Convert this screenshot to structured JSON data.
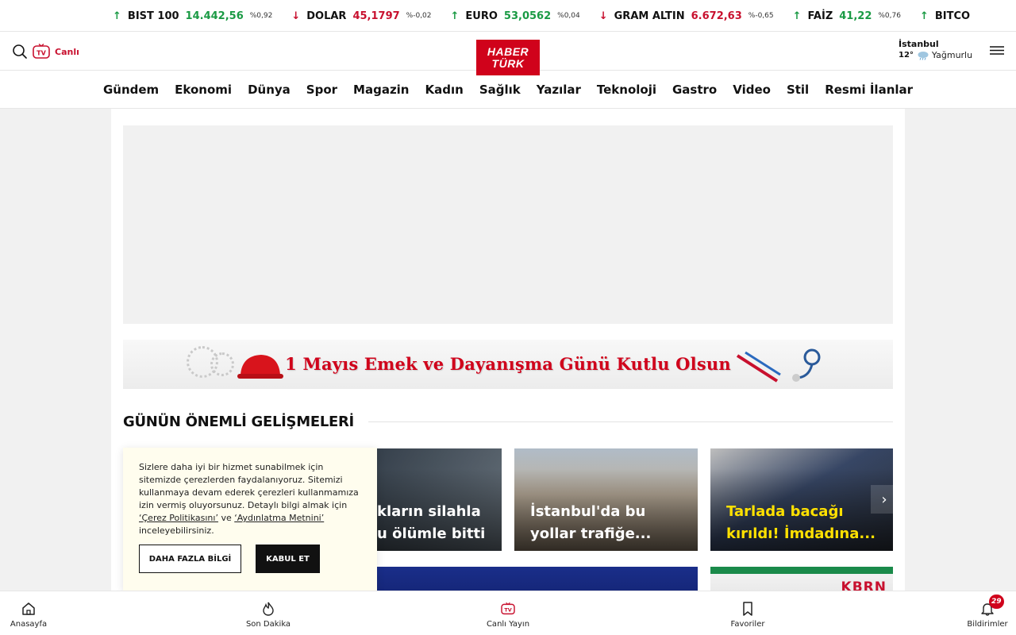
{
  "ticker": [
    {
      "name": "BIST 100",
      "value": "14.442,56",
      "change": "%0,92",
      "dir": "up",
      "arrow": "↑"
    },
    {
      "name": "DOLAR",
      "value": "45,1797",
      "change": "%-0,02",
      "dir": "down",
      "arrow": "↓"
    },
    {
      "name": "EURO",
      "value": "53,0562",
      "change": "%0,04",
      "dir": "up",
      "arrow": "↑"
    },
    {
      "name": "GRAM ALTIN",
      "value": "6.672,63",
      "change": "%-0,65",
      "dir": "down",
      "arrow": "↓"
    },
    {
      "name": "FAİZ",
      "value": "41,22",
      "change": "%0,76",
      "dir": "up",
      "arrow": "↑"
    },
    {
      "name": "BITCO",
      "value": "",
      "change": "",
      "dir": "up",
      "arrow": "↑"
    }
  ],
  "header": {
    "live_label": "Canlı",
    "tv_text": "TV",
    "logo_line1": "HABER",
    "logo_line2": "TÜRK",
    "city": "İstanbul",
    "temperature": "12°",
    "condition": "Yağmurlu"
  },
  "nav": [
    "Gündem",
    "Ekonomi",
    "Dünya",
    "Spor",
    "Magazin",
    "Kadın",
    "Sağlık",
    "Yazılar",
    "Teknoloji",
    "Gastro",
    "Video",
    "Stil",
    "Resmi İlanlar"
  ],
  "banner": {
    "text": "1 Mayıs Emek ve Dayanışma Günü Kutlu Olsun"
  },
  "section": {
    "title": "GÜNÜN ÖNEMLİ GELİŞMELERİ"
  },
  "cards": [
    {
      "title": "kların silahla\nu ölümle bitti"
    },
    {
      "title": "İstanbul'da bu yollar trafiğe..."
    },
    {
      "title": "Tarlada bacağı kırıldı! İmdadına..."
    }
  ],
  "card_b2_text": "KBRN",
  "cookie": {
    "text_before": "Sizlere daha iyi bir hizmet sunabilmek için sitemizde çerezlerden faydalanıyoruz. Sitemizi kullanmaya devam ederek çerezleri kullanmamıza izin vermiş oluyorsunuz. Detaylı bilgi almak için ",
    "link1": "‘Çerez Politikasını’",
    "middle": " ve ",
    "link2": "‘Aydınlatma Metnini’",
    "text_after": " inceleyebilirsiniz.",
    "more_label": "DAHA FAZLA BİLGİ",
    "accept_label": "KABUL ET"
  },
  "bottom_nav": {
    "home": "Anasayfa",
    "breaking": "Son Dakika",
    "live": "Canlı Yayın",
    "favorites": "Favoriler",
    "notifications": "Bildirimler",
    "notification_count": "29"
  },
  "colors": {
    "brand": "#d0021b",
    "up": "#1a9a44",
    "down": "#c8102e",
    "headline_yellow": "#ffe100"
  }
}
